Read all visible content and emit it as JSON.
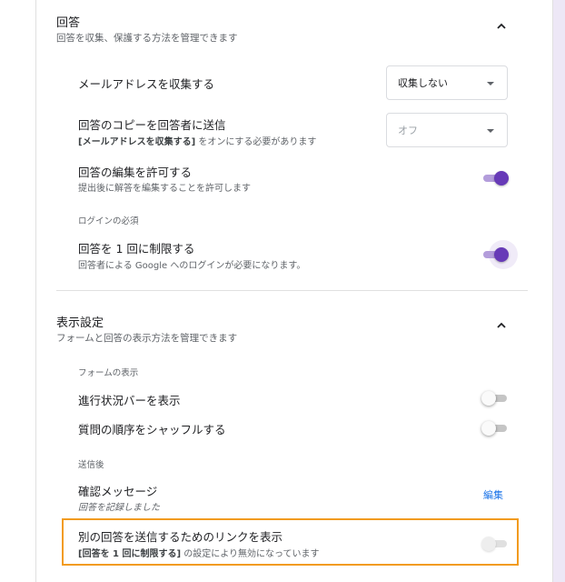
{
  "colors": {
    "accent": "#673ab7",
    "highlight_border": "#f29b1d",
    "link": "#1a73e8"
  },
  "responses_section": {
    "title": "回答",
    "subtitle": "回答を収集、保護する方法を管理できます",
    "expanded_icon": "chevron-up-icon",
    "collect_email": {
      "title": "メールアドレスを収集する",
      "select_value": "収集しない"
    },
    "send_copy": {
      "title": "回答のコピーを回答者に送信",
      "subtitle_bold": "[メールアドレスを収集する]",
      "subtitle_rest": " をオンにする必要があります",
      "select_value": "オフ",
      "disabled": true
    },
    "allow_edit": {
      "title": "回答の編集を許可する",
      "subtitle": "提出後に解答を編集することを許可します",
      "on": true
    },
    "login_required_label": "ログインの必須",
    "limit_one": {
      "title": "回答を 1 回に制限する",
      "subtitle": "回答者による Google へのログインが必要になります。",
      "on": true
    }
  },
  "display_section": {
    "title": "表示設定",
    "subtitle": "フォームと回答の表示方法を管理できます",
    "expanded_icon": "chevron-up-icon",
    "form_display_label": "フォームの表示",
    "progress_bar": {
      "title": "進行状況バーを表示",
      "on": false
    },
    "shuffle": {
      "title": "質問の順序をシャッフルする",
      "on": false
    },
    "after_submit_label": "送信後",
    "confirmation": {
      "title": "確認メッセージ",
      "subtitle": "回答を記録しました",
      "edit_label": "編集"
    },
    "another_response_link": {
      "title": "別の回答を送信するためのリンクを表示",
      "subtitle_bold": "[回答を 1 回に制限する]",
      "subtitle_rest": " の設定により無効になっています",
      "on": false,
      "disabled": true
    }
  }
}
